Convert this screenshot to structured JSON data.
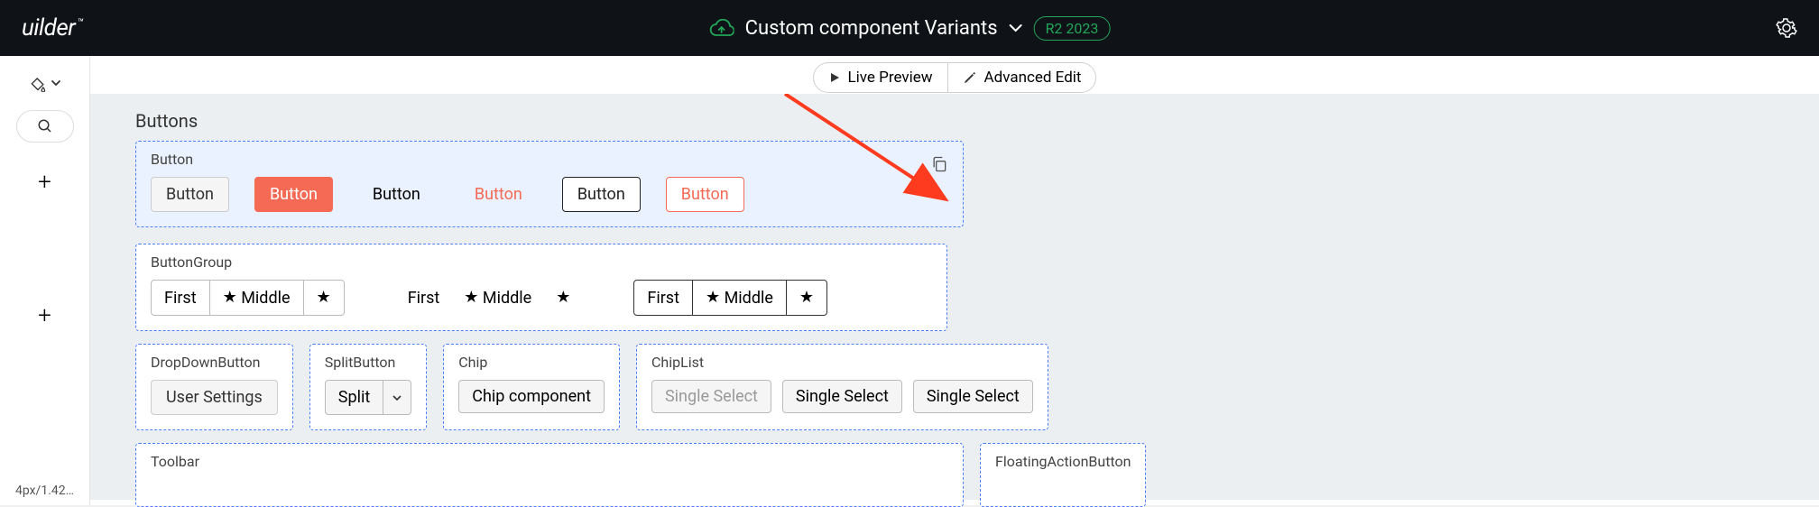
{
  "app": {
    "logo": "uilder",
    "tm": "™"
  },
  "header": {
    "project_name": "Custom component Variants",
    "release_tag": "R2 2023"
  },
  "preview": {
    "live_label": "Live Preview",
    "advanced_label": "Advanced Edit"
  },
  "sidebar": {
    "footer": "4px/1.42…"
  },
  "buttons": {
    "section_title": "Buttons",
    "button_card": {
      "title": "Button",
      "b1": "Button",
      "b2": "Button",
      "b3": "Button",
      "b4": "Button",
      "b5": "Button",
      "b6": "Button"
    },
    "button_group_card": {
      "title": "ButtonGroup",
      "first": "First",
      "middle": "Middle",
      "first2": "First",
      "middle2": "Middle",
      "first3": "First",
      "middle3": "Middle"
    },
    "dropdown_card": {
      "title": "DropDownButton",
      "label": "User Settings"
    },
    "split_card": {
      "title": "SplitButton",
      "label": "Split"
    },
    "chip_card": {
      "title": "Chip",
      "label": "Chip component"
    },
    "chiplist_card": {
      "title": "ChipList",
      "c1": "Single Select",
      "c2": "Single Select",
      "c3": "Single Select"
    },
    "toolbar_card": {
      "title": "Toolbar"
    },
    "fab_card": {
      "title": "FloatingActionButton"
    }
  }
}
